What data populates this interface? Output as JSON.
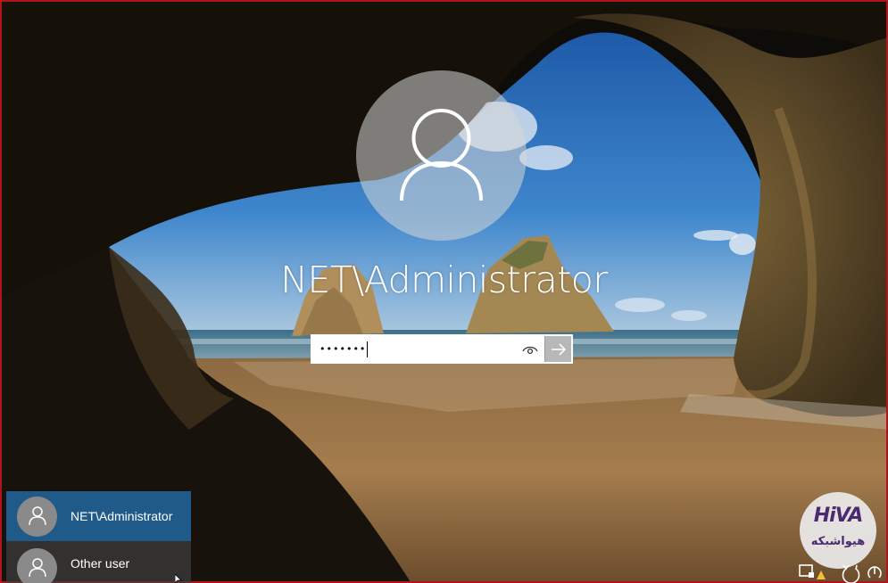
{
  "login": {
    "username": "NET\\Administrator",
    "password_mask": "•••••••",
    "reveal_icon": "eye-icon",
    "submit_icon": "arrow-right-icon"
  },
  "user_switcher": {
    "items": [
      {
        "label": "NET\\Administrator",
        "selected": true
      },
      {
        "label": "Other user",
        "selected": false
      }
    ]
  },
  "watermark": {
    "mark": "HiVA",
    "text": "هیواشبکه"
  },
  "system_tray": {
    "icons": [
      "network-icon",
      "ease-of-access-icon",
      "power-icon"
    ]
  },
  "colors": {
    "accent": "#1f5a88",
    "frame_border": "#b0141c",
    "submit_button": "#b8b8b8",
    "logo_purple": "#4b2a72"
  }
}
